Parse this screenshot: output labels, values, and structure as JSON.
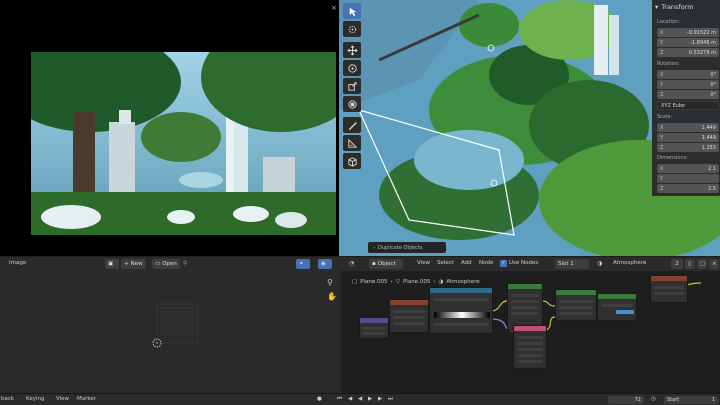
{
  "render_view": {
    "close_glyph": "×"
  },
  "toolbar": {
    "tools": [
      {
        "name": "select-icon",
        "active": true
      },
      {
        "name": "cursor-icon",
        "active": false
      },
      {
        "name": "move-icon",
        "active": false
      },
      {
        "name": "rotate-icon",
        "active": false
      },
      {
        "name": "scale-icon",
        "active": false
      },
      {
        "name": "transform-icon",
        "active": false
      },
      {
        "name": "annotate-icon",
        "active": false
      },
      {
        "name": "measure-icon",
        "active": false
      },
      {
        "name": "add-cube-icon",
        "active": false
      }
    ]
  },
  "transform_panel": {
    "title": "Transform",
    "location_label": "Location:",
    "location": [
      {
        "axis": "X",
        "value": "-0.91522 m"
      },
      {
        "axis": "Y",
        "value": "-1.8946 m"
      },
      {
        "axis": "Z",
        "value": "0.53278 m"
      }
    ],
    "rotation_label": "Rotation:",
    "rotation": [
      {
        "axis": "X",
        "value": "0°"
      },
      {
        "axis": "Y",
        "value": "0°"
      },
      {
        "axis": "Z",
        "value": "0°"
      }
    ],
    "rotation_mode": "XYZ Euler",
    "scale_label": "Scale:",
    "scale": [
      {
        "axis": "X",
        "value": "1.449"
      },
      {
        "axis": "Y",
        "value": "1.449"
      },
      {
        "axis": "Z",
        "value": "1.253"
      }
    ],
    "dimensions_label": "Dimensions:",
    "dimensions": [
      {
        "axis": "X",
        "value": "2.1"
      },
      {
        "axis": "Y",
        "value": ""
      },
      {
        "axis": "Z",
        "value": "2.5"
      }
    ]
  },
  "operator_toast": "Duplicate Objects",
  "image_editor": {
    "menu_image": "Image",
    "new_label": "New",
    "open_label": "Open"
  },
  "node_editor": {
    "object_label": "Object",
    "menus": [
      "View",
      "Select",
      "Add",
      "Node"
    ],
    "use_nodes_label": "Use Nodes",
    "slot_label": "Slot 1",
    "material_name": "Atmosphere",
    "user_count": "2",
    "breadcrumb": [
      "Plane.005",
      "Plane.005",
      "Atmosphere"
    ]
  },
  "timeline": {
    "menus": [
      "back",
      "Keying",
      "View",
      "Marker"
    ],
    "current_frame": "72",
    "start_label": "Start",
    "start_value": "1"
  },
  "colors": {
    "accent": "#4772b3",
    "header": "#2b2b2b",
    "panel": "#282828"
  }
}
